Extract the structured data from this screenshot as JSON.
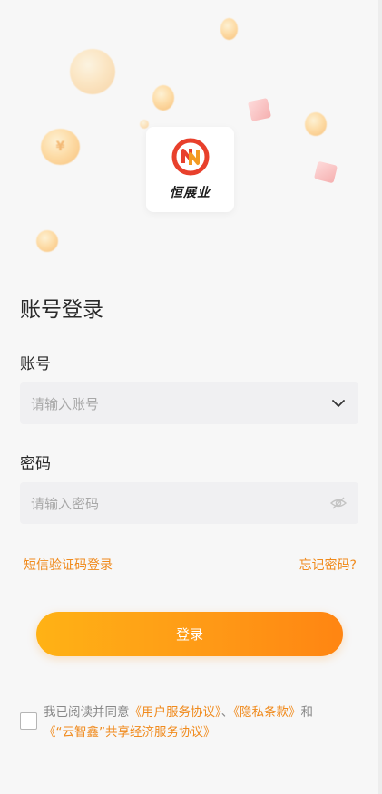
{
  "brand": {
    "logo_text": "恒展业",
    "logo_color": "#e8402c",
    "accent": "#ff9a16"
  },
  "login": {
    "title": "账号登录"
  },
  "account": {
    "label": "账号",
    "placeholder": "请输入账号",
    "dropdown_icon": "chevron-down-icon"
  },
  "password": {
    "label": "密码",
    "placeholder": "请输入密码",
    "visibility_icon": "eye-icon"
  },
  "links": {
    "sms_login": "短信验证码登录",
    "forgot_password": "忘记密码?"
  },
  "submit": {
    "label": "登录"
  },
  "agreement": {
    "checked": false,
    "prefix": "我已阅读并同意",
    "user_service": "《用户服务协议》",
    "sep1": "、",
    "privacy": "《隐私条款》",
    "and": "和",
    "shared_economy": "《“云智鑫”共享经济服务协议》"
  }
}
